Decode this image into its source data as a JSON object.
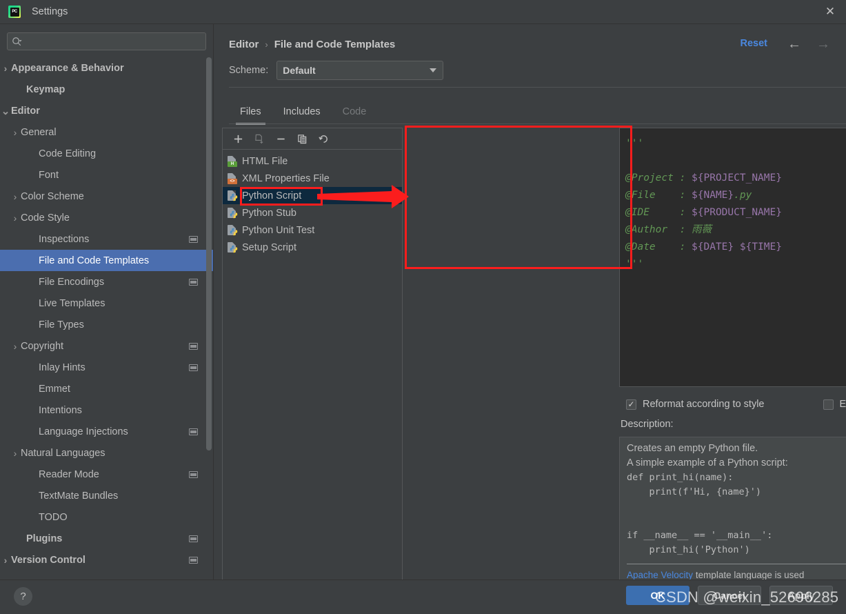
{
  "window": {
    "title": "Settings",
    "app_icon": "pycharm-icon",
    "close_icon": "close-icon"
  },
  "search": {
    "icon": "search-icon",
    "value": "",
    "placeholder": ""
  },
  "sidebar": {
    "items": [
      {
        "label": "Appearance & Behavior",
        "level": 0,
        "arrow": "collapsed",
        "bold": true,
        "badge": false,
        "selected": false
      },
      {
        "label": "Keymap",
        "level": 0,
        "arrow": "none",
        "bold": true,
        "badge": false,
        "selected": false
      },
      {
        "label": "Editor",
        "level": 0,
        "arrow": "expanded",
        "bold": true,
        "badge": false,
        "selected": false
      },
      {
        "label": "General",
        "level": 1,
        "arrow": "collapsed",
        "bold": false,
        "badge": false,
        "selected": false
      },
      {
        "label": "Code Editing",
        "level": 1,
        "arrow": "none",
        "bold": false,
        "badge": false,
        "selected": false
      },
      {
        "label": "Font",
        "level": 1,
        "arrow": "none",
        "bold": false,
        "badge": false,
        "selected": false
      },
      {
        "label": "Color Scheme",
        "level": 1,
        "arrow": "collapsed",
        "bold": false,
        "badge": false,
        "selected": false
      },
      {
        "label": "Code Style",
        "level": 1,
        "arrow": "collapsed",
        "bold": false,
        "badge": false,
        "selected": false
      },
      {
        "label": "Inspections",
        "level": 1,
        "arrow": "none",
        "bold": false,
        "badge": true,
        "selected": false
      },
      {
        "label": "File and Code Templates",
        "level": 1,
        "arrow": "none",
        "bold": false,
        "badge": false,
        "selected": true
      },
      {
        "label": "File Encodings",
        "level": 1,
        "arrow": "none",
        "bold": false,
        "badge": true,
        "selected": false
      },
      {
        "label": "Live Templates",
        "level": 1,
        "arrow": "none",
        "bold": false,
        "badge": false,
        "selected": false
      },
      {
        "label": "File Types",
        "level": 1,
        "arrow": "none",
        "bold": false,
        "badge": false,
        "selected": false
      },
      {
        "label": "Copyright",
        "level": 1,
        "arrow": "collapsed",
        "bold": false,
        "badge": true,
        "selected": false
      },
      {
        "label": "Inlay Hints",
        "level": 1,
        "arrow": "none",
        "bold": false,
        "badge": true,
        "selected": false
      },
      {
        "label": "Emmet",
        "level": 1,
        "arrow": "none",
        "bold": false,
        "badge": false,
        "selected": false
      },
      {
        "label": "Intentions",
        "level": 1,
        "arrow": "none",
        "bold": false,
        "badge": false,
        "selected": false
      },
      {
        "label": "Language Injections",
        "level": 1,
        "arrow": "none",
        "bold": false,
        "badge": true,
        "selected": false
      },
      {
        "label": "Natural Languages",
        "level": 1,
        "arrow": "collapsed",
        "bold": false,
        "badge": false,
        "selected": false
      },
      {
        "label": "Reader Mode",
        "level": 1,
        "arrow": "none",
        "bold": false,
        "badge": true,
        "selected": false
      },
      {
        "label": "TextMate Bundles",
        "level": 1,
        "arrow": "none",
        "bold": false,
        "badge": false,
        "selected": false
      },
      {
        "label": "TODO",
        "level": 1,
        "arrow": "none",
        "bold": false,
        "badge": false,
        "selected": false
      },
      {
        "label": "Plugins",
        "level": 0,
        "arrow": "none",
        "bold": true,
        "badge": true,
        "selected": false
      },
      {
        "label": "Version Control",
        "level": 0,
        "arrow": "collapsed",
        "bold": true,
        "badge": true,
        "selected": false
      }
    ]
  },
  "header": {
    "breadcrumb": [
      "Editor",
      "File and Code Templates"
    ],
    "separator": "›",
    "reset_label": "Reset",
    "back_icon": "arrow-left-icon",
    "forward_icon": "arrow-right-icon",
    "reset_color": "#4a88e0"
  },
  "scheme": {
    "label": "Scheme:",
    "value": "Default",
    "caret_icon": "chevron-down-icon"
  },
  "tabs": [
    {
      "label": "Files",
      "state": "active"
    },
    {
      "label": "Includes",
      "state": "normal"
    },
    {
      "label": "Code",
      "state": "disabled"
    }
  ],
  "file_list": {
    "toolbar": [
      {
        "name": "add-template-button",
        "glyph": "+",
        "enabled": true
      },
      {
        "name": "add-child-template-button",
        "glyph": "file-plus-icon",
        "enabled": false
      },
      {
        "name": "remove-template-button",
        "glyph": "−",
        "enabled": true
      },
      {
        "name": "copy-template-button",
        "glyph": "copy-icon",
        "enabled": true
      },
      {
        "name": "reset-template-button",
        "glyph": "undo-icon",
        "enabled": true
      }
    ],
    "items": [
      {
        "label": "HTML File",
        "icon": "html-file-icon",
        "badge": "H",
        "badge_color": "#5a9e3a",
        "selected": false
      },
      {
        "label": "XML Properties File",
        "icon": "xml-file-icon",
        "badge": "<>",
        "badge_color": "#d2713a",
        "selected": false
      },
      {
        "label": "Python Script",
        "icon": "python-file-icon",
        "badge": "",
        "badge_color": "",
        "selected": true
      },
      {
        "label": "Python Stub",
        "icon": "python-file-icon",
        "badge": "",
        "badge_color": "",
        "selected": false
      },
      {
        "label": "Python Unit Test",
        "icon": "python-file-icon",
        "badge": "",
        "badge_color": "",
        "selected": false
      },
      {
        "label": "Setup Script",
        "icon": "python-file-icon",
        "badge": "",
        "badge_color": "",
        "selected": false
      }
    ]
  },
  "editor": {
    "lines": [
      [
        {
          "t": "'''",
          "c": "comment"
        }
      ],
      [],
      [
        {
          "t": "@Project : ",
          "c": "comment"
        },
        {
          "t": "${PROJECT_NAME}",
          "c": "var"
        }
      ],
      [
        {
          "t": "@File    : ",
          "c": "comment"
        },
        {
          "t": "${NAME}",
          "c": "var"
        },
        {
          "t": ".py",
          "c": "comment"
        }
      ],
      [
        {
          "t": "@IDE     : ",
          "c": "comment"
        },
        {
          "t": "${PRODUCT_NAME}",
          "c": "var"
        }
      ],
      [
        {
          "t": "@Author  : 雨薇",
          "c": "comment"
        }
      ],
      [
        {
          "t": "@Date    : ",
          "c": "comment"
        },
        {
          "t": "${DATE} ${TIME}",
          "c": "var"
        }
      ],
      [
        {
          "t": "'''",
          "c": "comment"
        }
      ]
    ],
    "highlight_color": "#fb1d1d",
    "arrow_color": "#fb1d1d",
    "background": "#2b2b2b",
    "comment_color": "#629755",
    "variable_color": "#9876aa"
  },
  "options": {
    "reformat": {
      "label": "Reformat according to style",
      "checked": true,
      "check_glyph": "✓"
    },
    "live_templates": {
      "label": "Enable Live Templates",
      "checked": false,
      "check_glyph": ""
    }
  },
  "description": {
    "label": "Description:",
    "lines": [
      {
        "text": "Creates an empty Python file.",
        "mono": false
      },
      {
        "text": "A simple example of a Python script:",
        "mono": false
      },
      {
        "text": "def print_hi(name):",
        "mono": true
      },
      {
        "text": "    print(f'Hi, {name}')",
        "mono": true
      },
      {
        "text": "",
        "mono": true
      },
      {
        "text": "",
        "mono": true
      },
      {
        "text": "if __name__ == '__main__':",
        "mono": true
      },
      {
        "text": "    print_hi('Python')",
        "mono": true
      }
    ],
    "footer_link": "Apache Velocity",
    "footer_text": " template language is used"
  },
  "bottom": {
    "help_label": "?",
    "ok_label": "OK",
    "cancel_label": "Cancel",
    "apply_label": "Apply",
    "ok_color": "#3c6fb0"
  },
  "watermark": {
    "text": "CSDN @weixin_52696285"
  }
}
